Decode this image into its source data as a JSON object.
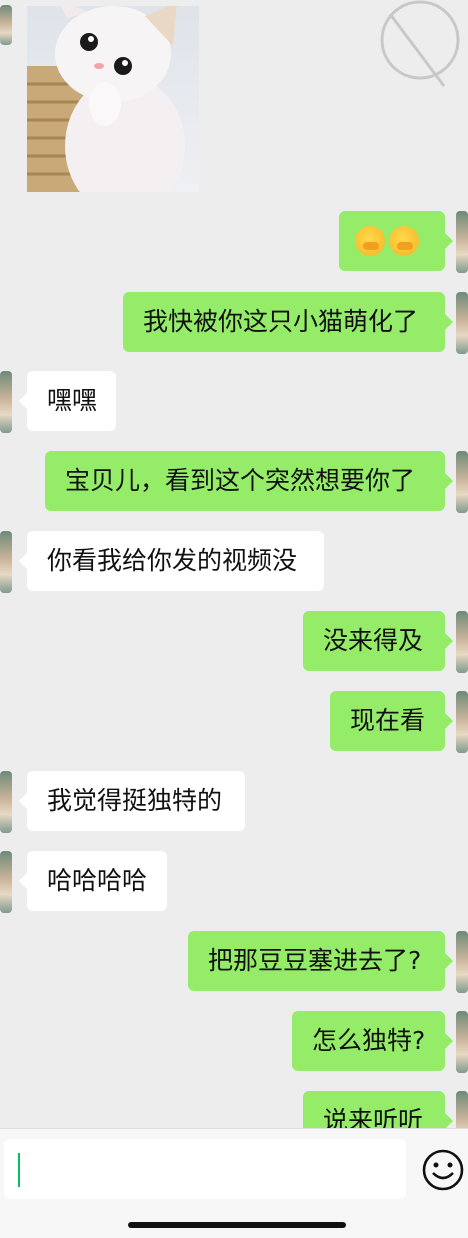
{
  "messages": [
    {
      "side": "in",
      "type": "image",
      "image_name": "kitten-photo"
    },
    {
      "side": "out",
      "type": "emoji",
      "emoji_name": "hand-over-mouth-emoji",
      "count": 2
    },
    {
      "side": "out",
      "type": "text",
      "text": "我快被你这只小猫萌化了"
    },
    {
      "side": "in",
      "type": "text",
      "text": "嘿嘿"
    },
    {
      "side": "out",
      "type": "text",
      "text": "宝贝儿，看到这个突然想要你了"
    },
    {
      "side": "in",
      "type": "text",
      "text": "你看我给你发的视频没"
    },
    {
      "side": "out",
      "type": "text",
      "text": "没来得及"
    },
    {
      "side": "out",
      "type": "text",
      "text": "现在看"
    },
    {
      "side": "in",
      "type": "text",
      "text": "我觉得挺独特的"
    },
    {
      "side": "in",
      "type": "text",
      "text": "哈哈哈哈"
    },
    {
      "side": "out",
      "type": "text",
      "text": "把那豆豆塞进去了?"
    },
    {
      "side": "out",
      "type": "text",
      "text": "怎么独特?"
    },
    {
      "side": "out",
      "type": "text",
      "text": "说来听听"
    }
  ],
  "input": {
    "value": "",
    "emoji_button_icon": "smiley-icon"
  },
  "colors": {
    "outgoing": "#95ec69",
    "incoming": "#ffffff",
    "background": "#ededed",
    "caret": "#07c160"
  }
}
